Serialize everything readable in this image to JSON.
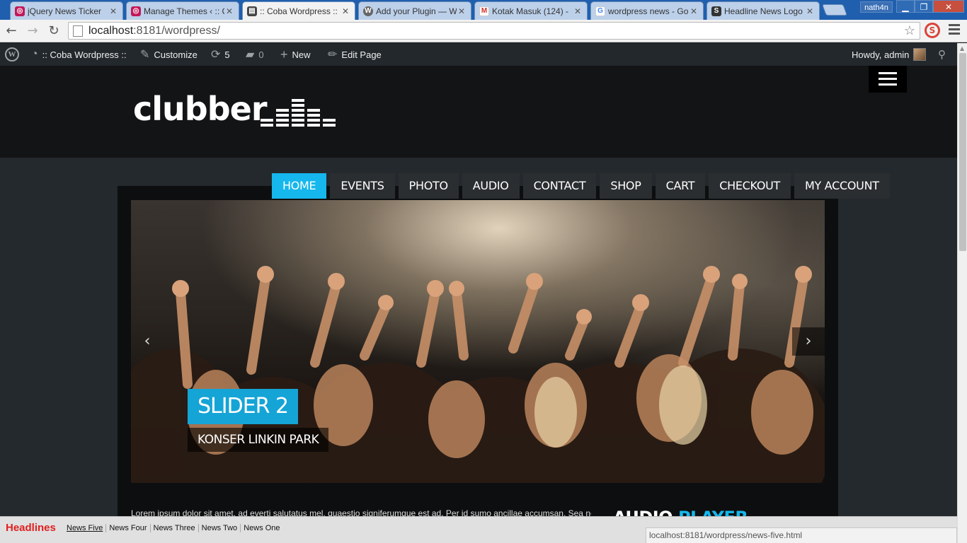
{
  "browser": {
    "tabs": [
      {
        "title": "jQuery News Ticker",
        "icon": "theme-icon"
      },
      {
        "title": "Manage Themes ‹ :: C",
        "icon": "theme-icon"
      },
      {
        "title": ":: Coba Wordpress ::",
        "icon": "equalizer-icon"
      },
      {
        "title": "Add your Plugin — W",
        "icon": "wordpress-icon"
      },
      {
        "title": "Kotak Masuk (124) -",
        "icon": "gmail-icon"
      },
      {
        "title": "wordpress news - Go",
        "icon": "google-icon"
      },
      {
        "title": "Headline News Logo",
        "icon": "s-icon"
      }
    ],
    "user": "nath4n",
    "url_host": "localhost",
    "url_path": ":8181/wordpress/",
    "status_url": "localhost:8181/wordpress/news-five.html"
  },
  "adminbar": {
    "site_name": ":: Coba Wordpress ::",
    "customize": "Customize",
    "updates": "5",
    "comments": "0",
    "new": "New",
    "edit_page": "Edit Page",
    "howdy": "Howdy, admin"
  },
  "site": {
    "logo": "clubber",
    "nav": [
      "HOME",
      "EVENTS",
      "PHOTO",
      "AUDIO",
      "CONTACT",
      "SHOP",
      "CART",
      "CHECKOUT",
      "MY ACCOUNT"
    ],
    "slider": {
      "title": "SLIDER 2",
      "subtitle": "KONSER LINKIN PARK"
    },
    "body_text": "Lorem ipsum dolor sit amet, ad everti salutatus mel, quaestio signiferumque est ad. Per id sumo ancillae accumsan. Sea ne",
    "widget_title_1": "AUDIO",
    "widget_title_2": "PLAYER"
  },
  "ticker": {
    "label": "Headlines",
    "items": [
      "News Five",
      "News Four",
      "News Three",
      "News Two",
      "News One"
    ]
  },
  "colors": {
    "accent": "#15b7ec",
    "headline_red": "#e02020",
    "adminbar": "#23282d"
  }
}
